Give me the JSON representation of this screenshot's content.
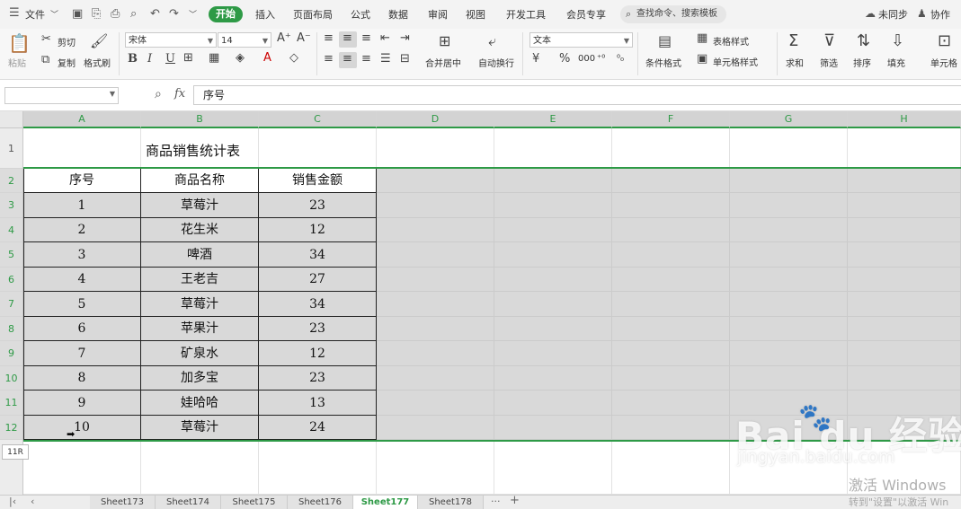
{
  "menubar": {
    "file_label": "文件",
    "tabs": [
      "开始",
      "插入",
      "页面布局",
      "公式",
      "数据",
      "审阅",
      "视图",
      "开发工具",
      "会员专享"
    ],
    "search_label": "查找命令、搜索模板",
    "sync_label": "未同步",
    "collab_label": "协作",
    "accent": "#2e9a46"
  },
  "ribbon": {
    "paste": "粘贴",
    "cut": "剪切",
    "copy": "复制",
    "format_painter": "格式刷",
    "font_name": "宋体",
    "font_size": "14",
    "bold": "B",
    "italic": "I",
    "underline": "U",
    "merge_center": "合并居中",
    "wrap_text": "自动换行",
    "number_format": "文本",
    "currency": "¥",
    "percent": "%",
    "thousands": "000",
    "table_style": "表格样式",
    "conditional_format": "条件格式",
    "cell_style": "单元格样式",
    "sum": "求和",
    "filter": "筛选",
    "sort": "排序",
    "fill": "填充",
    "cell": "单元格"
  },
  "formula_bar": {
    "name_box": "",
    "fx": "fx",
    "content": "序号"
  },
  "columns": [
    "A",
    "B",
    "C",
    "D",
    "E",
    "F",
    "G",
    "H"
  ],
  "rows": [
    "1",
    "2",
    "3",
    "4",
    "5",
    "6",
    "7",
    "8",
    "9",
    "10",
    "11",
    "12"
  ],
  "sheet": {
    "title": "商品销售统计表",
    "headers": [
      "序号",
      "商品名称",
      "销售金额"
    ],
    "data": [
      [
        "1",
        "草莓汁",
        "23"
      ],
      [
        "2",
        "花生米",
        "12"
      ],
      [
        "3",
        "啤酒",
        "34"
      ],
      [
        "4",
        "王老吉",
        "27"
      ],
      [
        "5",
        "草莓汁",
        "34"
      ],
      [
        "6",
        "苹果汁",
        "23"
      ],
      [
        "7",
        "矿泉水",
        "12"
      ],
      [
        "8",
        "加多宝",
        "23"
      ],
      [
        "9",
        "娃哈哈",
        "13"
      ],
      [
        "10",
        "草莓汁",
        "24"
      ]
    ]
  },
  "row_tip": "11R",
  "sheet_tabs": [
    "Sheet173",
    "Sheet174",
    "Sheet175",
    "Sheet176",
    "Sheet177",
    "Sheet178"
  ],
  "active_sheet": "Sheet177",
  "more_sheets": "···",
  "add_sheet": "+",
  "watermark": {
    "baidu": "Bai  du 经验",
    "url": "jingyan.baidu.com",
    "activate": "激活 Windows",
    "activate_hint": "转到\"设置\"以激活 Win"
  }
}
